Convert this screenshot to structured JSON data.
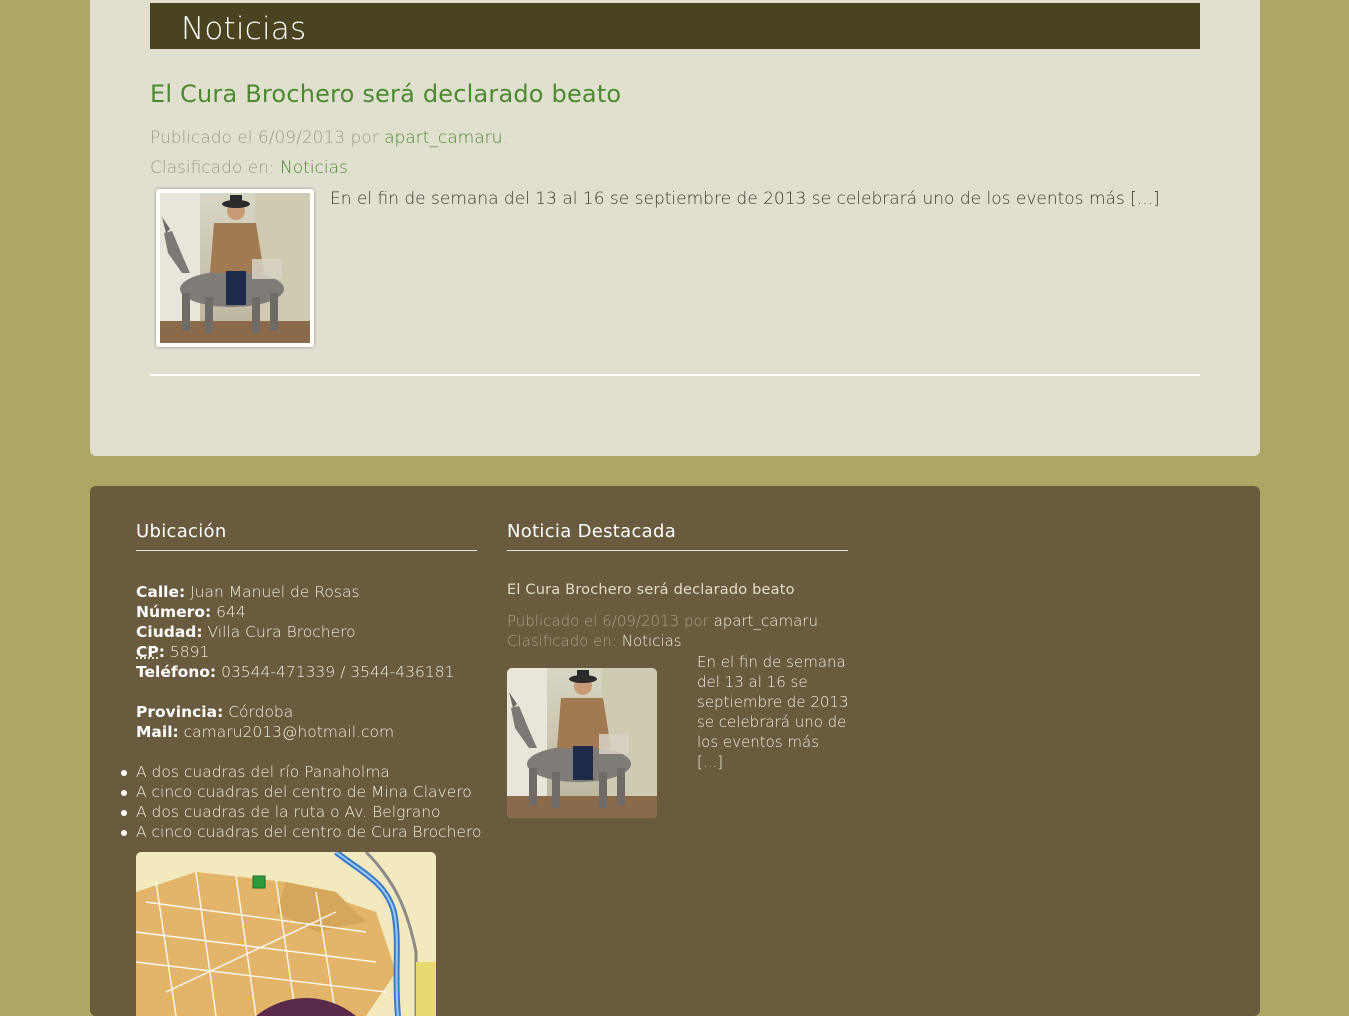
{
  "main": {
    "section_title": "Noticias",
    "post": {
      "title": "El Cura Brochero será declarado beato",
      "published_prefix": "Publicado el",
      "date": "6/09/2013",
      "by_word": "por",
      "author": "apart_camaru",
      "category_prefix": "Clasificado en:",
      "category": "Noticias",
      "excerpt": "En el fin de semana del 13 al 16 se septiembre de 2013 se celebrará uno de los eventos más [...]"
    }
  },
  "footer": {
    "ubicacion": {
      "title": "Ubicación",
      "calle_label": "Calle:",
      "calle": "Juan Manuel de Rosas",
      "numero_label": "Número:",
      "numero": "644",
      "ciudad_label": "Ciudad:",
      "ciudad": "Villa Cura Brochero",
      "cp_label": "CP",
      "cp": "5891",
      "telefono_label": "Teléfono:",
      "telefono": "03544-471339 / 3544-436181",
      "provincia_label": "Provincia:",
      "provincia": "Córdoba",
      "mail_label": "Mail:",
      "mail": "camaru2013@hotmail.com",
      "bullets": [
        "A dos cuadras del río Panaholma",
        "A cinco cuadras del centro de Mina Clavero",
        "A dos cuadras de la ruta o Av. Belgrano",
        "A cinco cuadras del centro de Cura Brochero"
      ]
    },
    "destacada": {
      "title": "Noticia Destacada",
      "post_title": "El Cura Brochero será declarado beato",
      "published_prefix": "Publicado el",
      "date": "6/09/2013",
      "by_word": "por",
      "author": "apart_camaru",
      "category_prefix": "Clasificado en:",
      "category": "Noticias",
      "excerpt": "En el fin de semana del 13 al 16 se septiembre de 2013 se celebrará uno de los eventos más [...]"
    }
  },
  "colors": {
    "page_background": "#ada664",
    "content_background": "#e1dfd0",
    "header_bar": "#4a4320",
    "link_green": "#4b8a2f",
    "footer_background": "#6a5a3e"
  },
  "icons": {
    "post_thumbnail": "cura-brochero-on-mule-photo",
    "map": "villa-cura-brochero-street-map"
  }
}
